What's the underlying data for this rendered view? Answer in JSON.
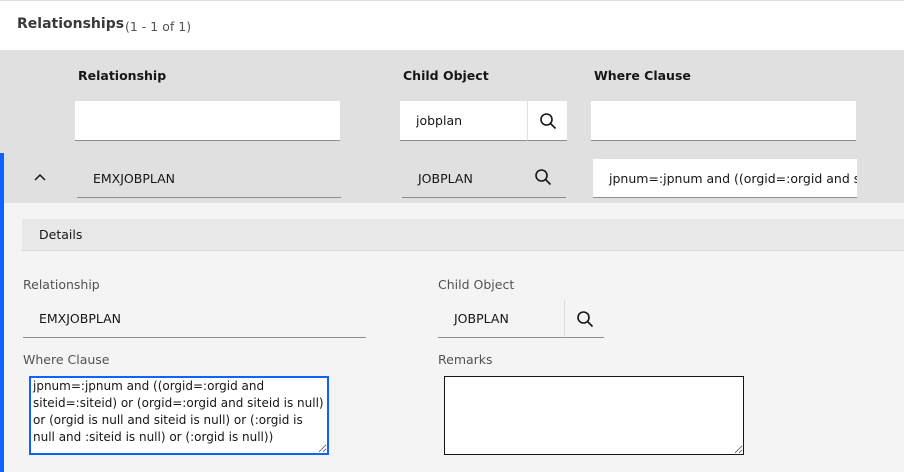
{
  "header": {
    "title": "Relationships",
    "count": "(1 - 1 of 1)"
  },
  "columns": {
    "relationship": "Relationship",
    "child_object": "Child Object",
    "where_clause": "Where Clause"
  },
  "filters": {
    "relationship": "",
    "child_object": "jobplan",
    "where_clause": ""
  },
  "row": {
    "relationship": "EMXJOBPLAN",
    "child_object": "JOBPLAN",
    "where_clause": "jpnum=:jpnum and ((orgid=:orgid and sit"
  },
  "details": {
    "title": "Details",
    "relationship_label": "Relationship",
    "relationship_value": "EMXJOBPLAN",
    "child_object_label": "Child Object",
    "child_object_value": "JOBPLAN",
    "where_clause_label": "Where Clause",
    "where_clause_value": "jpnum=:jpnum and ((orgid=:orgid and siteid=:siteid) or (orgid=:orgid and siteid is null) or (orgid is null and siteid is null) or (:orgid is null and :siteid is null) or (:orgid is null))",
    "remarks_label": "Remarks",
    "remarks_value": ""
  },
  "icons": {
    "search": "search-icon",
    "collapse": "chevron-up-icon"
  },
  "colors": {
    "accent": "#0f62fe",
    "table_bg": "#e0e0e0",
    "panel_bg": "#f4f4f4"
  }
}
